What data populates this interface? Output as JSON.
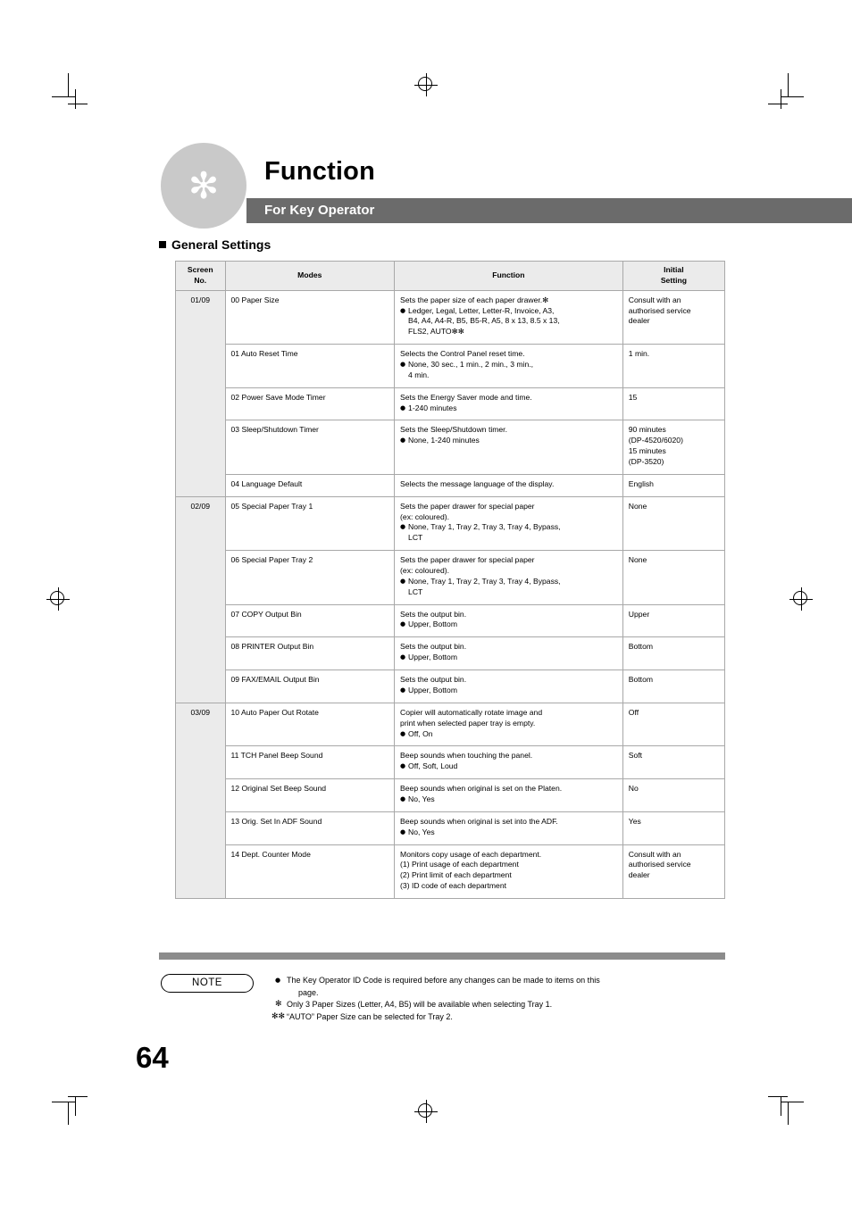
{
  "header": {
    "badge_icon": "asterisk-icon",
    "badge_glyph": "✻",
    "title": "Function",
    "subtitle": "For Key Operator",
    "subtitle_bar_color": "#6b6b6b"
  },
  "section": {
    "heading": "General Settings"
  },
  "table": {
    "columns": [
      "Screen\nNo.",
      "Modes",
      "Function",
      "Initial\nSetting"
    ],
    "col_screen_line1": "Screen",
    "col_screen_line2": "No.",
    "col_modes": "Modes",
    "col_function": "Function",
    "col_init_line1": "Initial",
    "col_init_line2": "Setting",
    "groups": [
      {
        "screen_no": "01/09",
        "rows": [
          {
            "mode": "00 Paper Size",
            "function_lines": [
              {
                "type": "plain",
                "text": "Sets the paper size of each paper drawer.✻"
              },
              {
                "type": "bullet",
                "text": "Ledger, Legal, Letter, Letter-R, Invoice, A3,"
              },
              {
                "type": "cont",
                "text": "B4, A4, A4-R, B5, B5-R, A5, 8 x 13, 8.5 x 13,"
              },
              {
                "type": "cont",
                "text": "FLS2, AUTO✻✻"
              }
            ],
            "initial_lines": [
              "Consult with an",
              "authorised service",
              "dealer"
            ]
          },
          {
            "mode": "01 Auto Reset Time",
            "function_lines": [
              {
                "type": "plain",
                "text": "Selects the Control Panel reset time."
              },
              {
                "type": "bullet",
                "text": "None, 30 sec., 1 min., 2 min., 3 min.,"
              },
              {
                "type": "cont",
                "text": "4 min."
              }
            ],
            "initial_lines": [
              "1 min."
            ]
          },
          {
            "mode": "02 Power Save Mode Timer",
            "function_lines": [
              {
                "type": "plain",
                "text": "Sets the Energy Saver mode and time."
              },
              {
                "type": "bullet",
                "text": "1-240 minutes"
              }
            ],
            "initial_lines": [
              "15"
            ]
          },
          {
            "mode": "03 Sleep/Shutdown Timer",
            "function_lines": [
              {
                "type": "plain",
                "text": "Sets the Sleep/Shutdown timer."
              },
              {
                "type": "bullet",
                "text": "None, 1-240 minutes"
              }
            ],
            "initial_lines": [
              "90 minutes",
              "(DP-4520/6020)",
              "15 minutes",
              "(DP-3520)"
            ]
          },
          {
            "mode": "04 Language Default",
            "function_lines": [
              {
                "type": "plain",
                "text": "Selects the message language of the display."
              }
            ],
            "initial_lines": [
              "English"
            ]
          }
        ]
      },
      {
        "screen_no": "02/09",
        "rows": [
          {
            "mode": "05 Special Paper Tray 1",
            "function_lines": [
              {
                "type": "plain",
                "text": "Sets the paper drawer for special paper"
              },
              {
                "type": "plain",
                "text": "(ex: coloured)."
              },
              {
                "type": "bullet",
                "text": "None, Tray 1, Tray 2, Tray 3, Tray 4, Bypass,"
              },
              {
                "type": "cont",
                "text": "LCT"
              }
            ],
            "initial_lines": [
              "None"
            ]
          },
          {
            "mode": "06 Special Paper Tray 2",
            "function_lines": [
              {
                "type": "plain",
                "text": "Sets the paper drawer for special paper"
              },
              {
                "type": "plain",
                "text": "(ex: coloured)."
              },
              {
                "type": "bullet",
                "text": "None, Tray 1, Tray 2, Tray 3, Tray 4, Bypass,"
              },
              {
                "type": "cont",
                "text": "LCT"
              }
            ],
            "initial_lines": [
              "None"
            ]
          },
          {
            "mode": "07 COPY Output Bin",
            "function_lines": [
              {
                "type": "plain",
                "text": "Sets the output bin."
              },
              {
                "type": "bullet",
                "text": "Upper, Bottom"
              }
            ],
            "initial_lines": [
              "Upper"
            ]
          },
          {
            "mode": "08 PRINTER Output Bin",
            "function_lines": [
              {
                "type": "plain",
                "text": "Sets the output bin."
              },
              {
                "type": "bullet",
                "text": "Upper, Bottom"
              }
            ],
            "initial_lines": [
              "Bottom"
            ]
          },
          {
            "mode": "09 FAX/EMAIL Output Bin",
            "function_lines": [
              {
                "type": "plain",
                "text": "Sets the output bin."
              },
              {
                "type": "bullet",
                "text": "Upper, Bottom"
              }
            ],
            "initial_lines": [
              "Bottom"
            ]
          }
        ]
      },
      {
        "screen_no": "03/09",
        "rows": [
          {
            "mode": "10 Auto Paper Out Rotate",
            "function_lines": [
              {
                "type": "plain",
                "text": "Copier will automatically rotate image and"
              },
              {
                "type": "plain",
                "text": "print when selected paper tray is empty."
              },
              {
                "type": "bullet",
                "text": "Off, On"
              }
            ],
            "initial_lines": [
              "Off"
            ]
          },
          {
            "mode": "11 TCH Panel Beep Sound",
            "function_lines": [
              {
                "type": "plain",
                "text": "Beep sounds when touching the panel."
              },
              {
                "type": "bullet",
                "text": "Off, Soft, Loud"
              }
            ],
            "initial_lines": [
              "Soft"
            ]
          },
          {
            "mode": "12 Original Set Beep Sound",
            "function_lines": [
              {
                "type": "plain",
                "text": "Beep sounds when original is set on the Platen."
              },
              {
                "type": "bullet",
                "text": "No, Yes"
              }
            ],
            "initial_lines": [
              "No"
            ]
          },
          {
            "mode": "13 Orig. Set In ADF Sound",
            "function_lines": [
              {
                "type": "plain",
                "text": "Beep sounds when original is set into the ADF."
              },
              {
                "type": "bullet",
                "text": "No, Yes"
              }
            ],
            "initial_lines": [
              "Yes"
            ]
          },
          {
            "mode": "14 Dept. Counter Mode",
            "function_lines": [
              {
                "type": "plain",
                "text": "Monitors copy usage of each department."
              },
              {
                "type": "plain",
                "text": "(1) Print usage of each department"
              },
              {
                "type": "plain",
                "text": "(2) Print limit of each department"
              },
              {
                "type": "plain",
                "text": "(3) ID code of each department"
              }
            ],
            "initial_lines": [
              "Consult with an",
              "authorised service",
              "dealer"
            ]
          }
        ]
      }
    ]
  },
  "note": {
    "label": "NOTE",
    "items": [
      {
        "mark": "●",
        "mark_type": "dot",
        "lines": [
          "The Key Operator ID Code is required before any changes can be made to items on this",
          "page."
        ]
      },
      {
        "mark": "✻",
        "mark_type": "star",
        "lines": [
          "Only 3 Paper Sizes (Letter, A4, B5) will be available when selecting Tray 1."
        ]
      },
      {
        "mark": "✻✻",
        "mark_type": "star2",
        "lines": [
          "“AUTO” Paper Size can be selected for Tray 2."
        ]
      }
    ]
  },
  "page_number": "64"
}
